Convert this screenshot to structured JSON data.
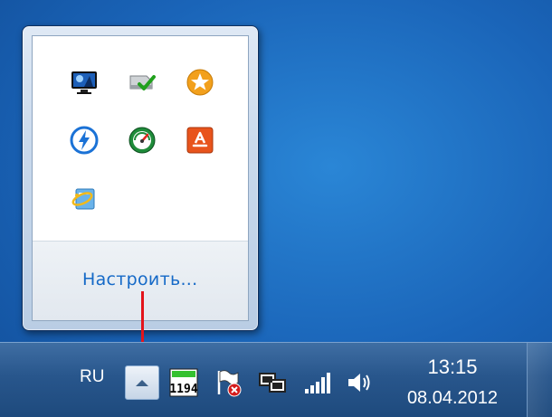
{
  "flyout": {
    "icons": [
      {
        "name": "display-monitor-icon"
      },
      {
        "name": "safely-remove-hardware-icon"
      },
      {
        "name": "star-app-icon"
      },
      {
        "name": "bolt-app-icon"
      },
      {
        "name": "speedometer-icon"
      },
      {
        "name": "orange-app-icon"
      },
      {
        "name": "folder-sync-icon"
      }
    ],
    "customize_label": "Настроить..."
  },
  "taskbar": {
    "language": "RU",
    "network_meter_value": "1194",
    "clock": {
      "time": "13:15",
      "date": "08.04.2012"
    }
  },
  "colors": {
    "desktop": "#1a64b8",
    "taskbar": "#28568c",
    "link": "#1569c7",
    "pointer": "#e3141b"
  }
}
